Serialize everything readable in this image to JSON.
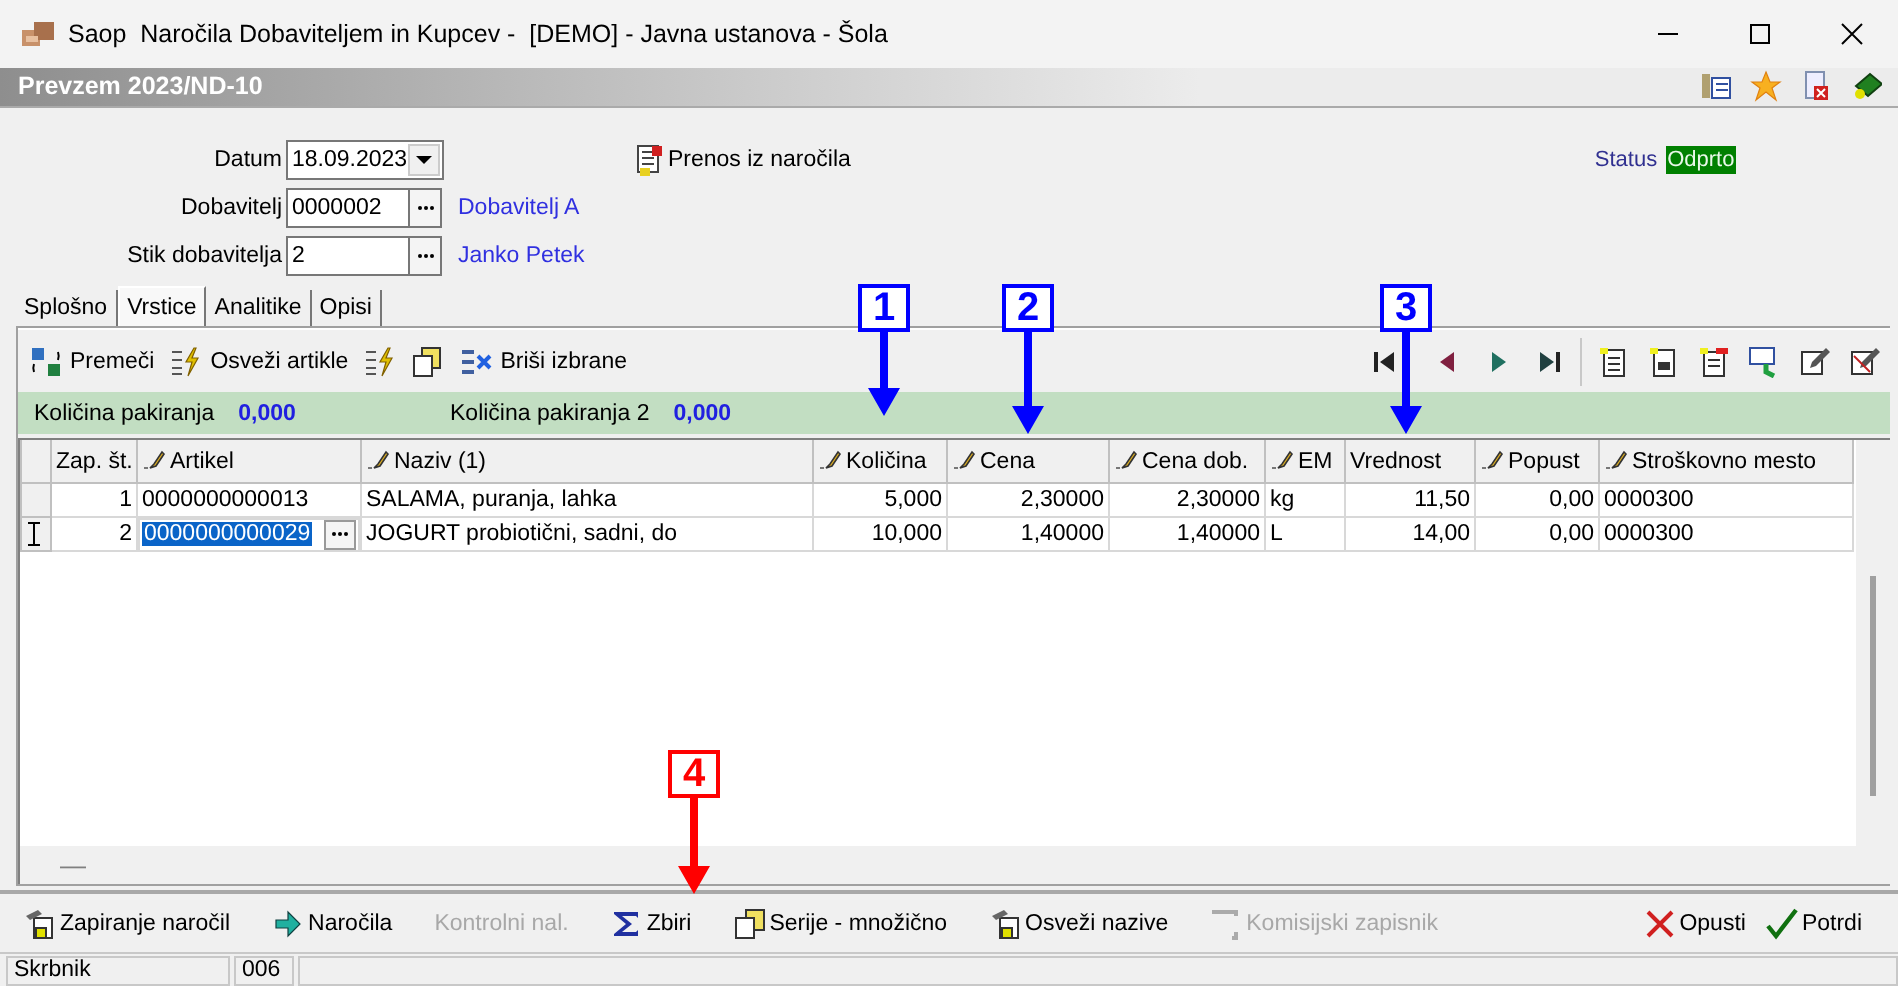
{
  "window": {
    "title": "Saop  Naročila Dobaviteljem in Kupcev -  [DEMO] - Javna ustanova - Šola"
  },
  "document": {
    "title": "Prevzem 2023/ND-10"
  },
  "form": {
    "fields": [
      {
        "kind": "date",
        "label": "Datum",
        "value": "18.09.2023"
      },
      {
        "kind": "lookup",
        "label": "Dobavitelj",
        "value": "0000002",
        "link": "Dobavitelj A"
      },
      {
        "kind": "lookup",
        "label": "Stik dobavitelja",
        "value": "2",
        "link": "Janko Petek"
      }
    ],
    "transfer_link": "Prenos iz naročila",
    "status": {
      "label": "Status",
      "value": "Odprto"
    }
  },
  "tabs": [
    {
      "label": "Splošno",
      "selected": false
    },
    {
      "label": "Vrstice",
      "selected": true
    },
    {
      "label": "Analitike",
      "selected": false
    },
    {
      "label": "Opisi",
      "selected": false
    }
  ],
  "toolbar": {
    "buttons": [
      "Premeči",
      "Osveži artikle",
      "Briši izbrane"
    ]
  },
  "packaging": [
    {
      "label": "Količina pakiranja",
      "value": "0,000"
    },
    {
      "label": "Količina pakiranja 2",
      "value": "0,000"
    }
  ],
  "table": {
    "columns": [
      {
        "label": "Zap. št.",
        "editable": false
      },
      {
        "label": "Artikel",
        "editable": true
      },
      {
        "label": "Naziv (1)",
        "editable": true
      },
      {
        "label": "Količina",
        "editable": true
      },
      {
        "label": "Cena",
        "editable": true
      },
      {
        "label": "Cena dob.",
        "editable": true
      },
      {
        "label": "EM",
        "editable": true
      },
      {
        "label": "Vrednost",
        "editable": false
      },
      {
        "label": "Popust",
        "editable": true
      },
      {
        "label": "Stroškovno mesto",
        "editable": true
      }
    ],
    "rows": [
      {
        "current": false,
        "cells": [
          "1",
          "0000000000013",
          "SALAMA, puranja, lahka",
          "5,000",
          "2,30000",
          "2,30000",
          "kg",
          "11,50",
          "0,00",
          "0000300"
        ]
      },
      {
        "current": true,
        "cells": [
          "2",
          "0000000000029",
          "JOGURT probiotični, sadni, do",
          "10,000",
          "1,40000",
          "1,40000",
          "L",
          "14,00",
          "0,00",
          "0000300"
        ]
      }
    ],
    "footer": "—"
  },
  "bottom_buttons": [
    {
      "label": "Zapiranje naročil",
      "disabled": false
    },
    {
      "label": "Naročila",
      "disabled": false
    },
    {
      "label": "Kontrolni nal.",
      "disabled": true
    },
    {
      "label": "Zbiri",
      "disabled": false
    },
    {
      "label": "Serije - množično",
      "disabled": false
    },
    {
      "label": "Osveži nazive",
      "disabled": false
    },
    {
      "label": "Komisijski zapisnik",
      "disabled": true
    },
    {
      "label": "Opusti",
      "disabled": false
    },
    {
      "label": "Potrdi",
      "disabled": false
    }
  ],
  "status_bar": [
    "Skrbnik",
    "006"
  ],
  "callouts": [
    {
      "number": "1",
      "color": "#0000ff"
    },
    {
      "number": "2",
      "color": "#0000ff"
    },
    {
      "number": "3",
      "color": "#0000ff"
    },
    {
      "number": "4",
      "color": "#ff0000"
    }
  ]
}
